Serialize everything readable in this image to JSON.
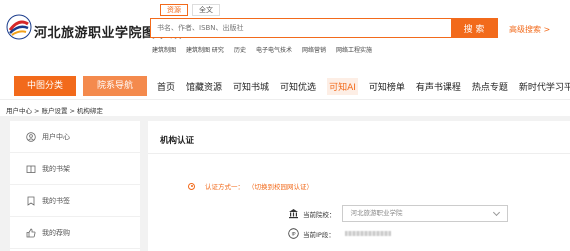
{
  "header": {
    "site_name": "河北旅游职业学院图书馆",
    "search_tabs": [
      {
        "label": "资源",
        "active": true
      },
      {
        "label": "全文",
        "active": false
      }
    ],
    "search_placeholder": "书名、作者、ISBN、出版社",
    "search_button": "搜 索",
    "advanced_search": "高级搜索 >",
    "hot_tags": [
      "建筑制图",
      "建筑制图 研究",
      "历史",
      "电子电气技术",
      "网络营销",
      "网络工程实施"
    ]
  },
  "nav": {
    "categories": [
      "中图分类",
      "院系导航"
    ],
    "items": [
      "首页",
      "馆藏资源",
      "可知书城",
      "可知优选",
      "可知AI",
      "可知榜单",
      "有声书课程",
      "热点专题",
      "新时代学习平台"
    ],
    "active_item": "可知AI"
  },
  "breadcrumb": [
    "用户中心",
    "账户设置",
    "机构绑定"
  ],
  "breadcrumb_separator": ">",
  "sidebar": {
    "items": [
      {
        "label": "用户中心",
        "icon": "user-circle-icon"
      },
      {
        "label": "我的书架",
        "icon": "book-open-icon"
      },
      {
        "label": "我的书签",
        "icon": "bookmark-icon"
      },
      {
        "label": "我的荐购",
        "icon": "thumbs-up-icon"
      }
    ]
  },
  "panel": {
    "title": "机构认证",
    "method_label": "认证方式一：",
    "method_switch": "（切换到校园网认证）",
    "school_label": "当前院校：",
    "school_value": "河北旅游职业学院",
    "ip_label": "当前IP段："
  },
  "colors": {
    "accent": "#f26a1b",
    "accent_light": "#f48a4d",
    "page_bg": "#f2f2f2"
  }
}
